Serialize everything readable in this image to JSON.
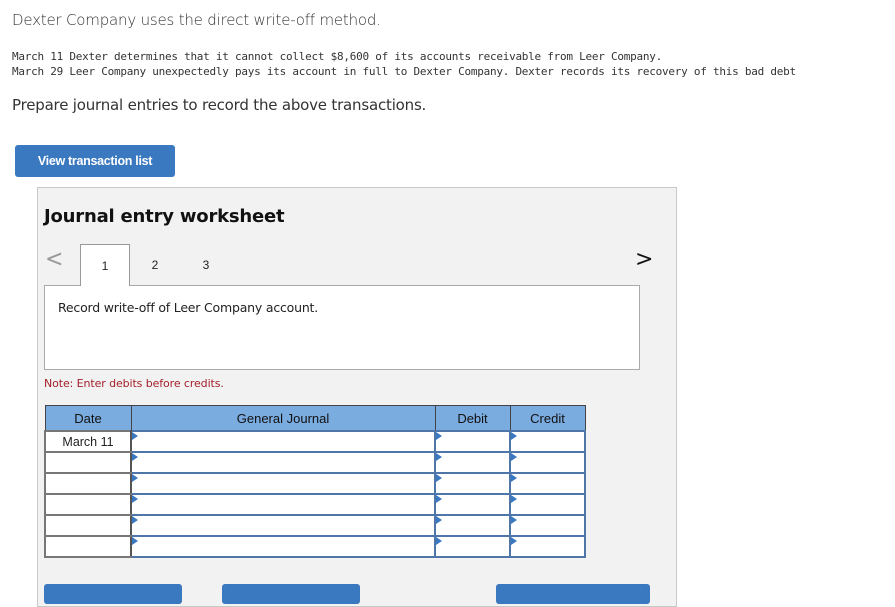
{
  "problem": {
    "intro": "Dexter Company uses the direct write-off method.",
    "transactions": [
      {
        "date": "March 11",
        "text": "Dexter determines that it cannot collect $8,600 of its accounts receivable from Leer Company."
      },
      {
        "date": "March 29",
        "text": "Leer Company unexpectedly pays its account in full to Dexter Company. Dexter records its recovery of this bad debt"
      }
    ],
    "instruction": "Prepare journal entries to record the above transactions."
  },
  "buttons": {
    "view_transaction_list": "View transaction list"
  },
  "worksheet": {
    "title": "Journal entry worksheet",
    "prev_icon": "chevron-left-icon",
    "next_icon": "chevron-right-icon",
    "prev_glyph": "<",
    "next_glyph": ">",
    "tabs": [
      {
        "label": "1",
        "active": true
      },
      {
        "label": "2",
        "active": false
      },
      {
        "label": "3",
        "active": false
      }
    ],
    "description": "Record write-off of Leer Company account.",
    "note": "Note: Enter debits before credits.",
    "table": {
      "headers": {
        "date": "Date",
        "journal": "General Journal",
        "debit": "Debit",
        "credit": "Credit"
      },
      "rows": [
        {
          "date": "March 11",
          "account": "",
          "debit": "",
          "credit": ""
        },
        {
          "date": "",
          "account": "",
          "debit": "",
          "credit": ""
        },
        {
          "date": "",
          "account": "",
          "debit": "",
          "credit": ""
        },
        {
          "date": "",
          "account": "",
          "debit": "",
          "credit": ""
        },
        {
          "date": "",
          "account": "",
          "debit": "",
          "credit": ""
        },
        {
          "date": "",
          "account": "",
          "debit": "",
          "credit": ""
        }
      ]
    }
  },
  "colors": {
    "primary_button": "#3a78c0",
    "table_header": "#7aacdf",
    "note_text": "#a31f2a",
    "panel_bg": "#f2f2f2"
  }
}
